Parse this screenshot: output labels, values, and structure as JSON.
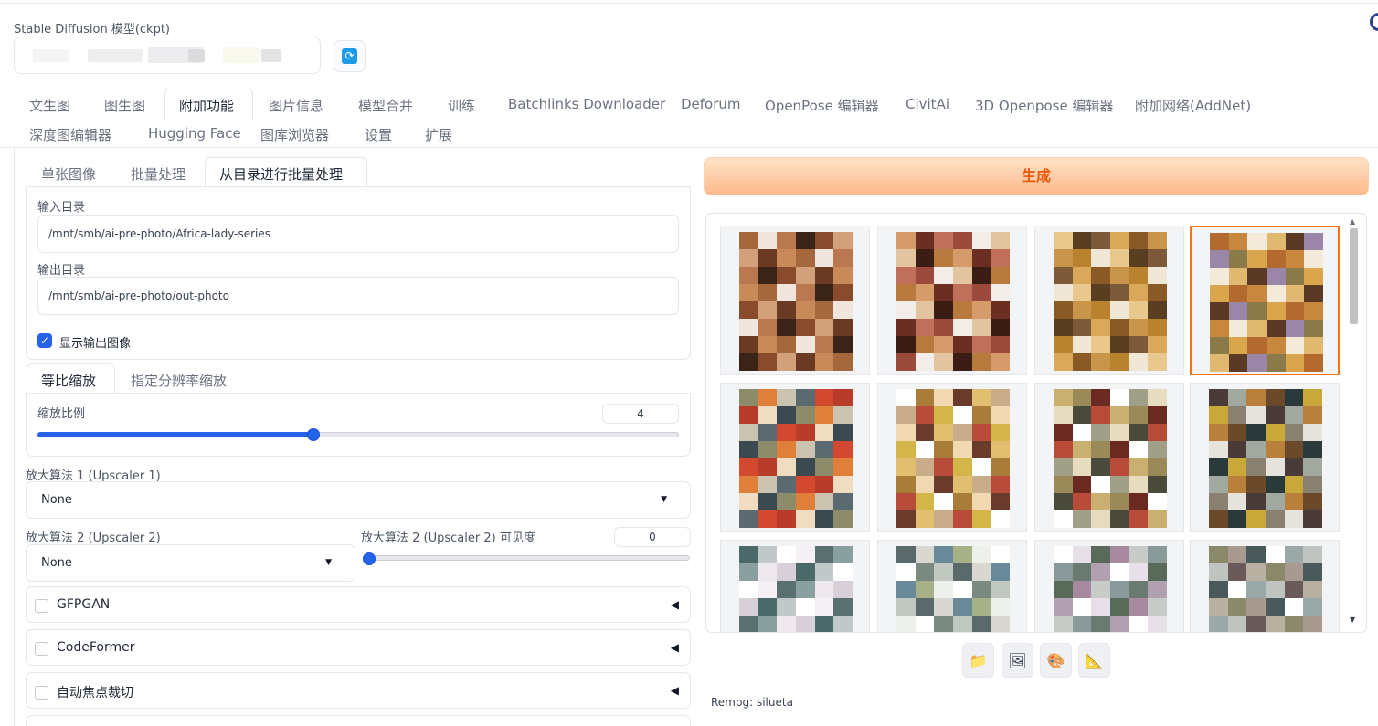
{
  "model": {
    "label": "Stable Diffusion 模型(ckpt)",
    "refresh_icon": "refresh-icon"
  },
  "main_tabs": [
    {
      "label": "文生图"
    },
    {
      "label": "图生图"
    },
    {
      "label": "附加功能",
      "active": true
    },
    {
      "label": "图片信息"
    },
    {
      "label": "模型合并"
    },
    {
      "label": "训练"
    },
    {
      "label": "Batchlinks Downloader"
    },
    {
      "label": "Deforum"
    },
    {
      "label": "OpenPose 编辑器"
    },
    {
      "label": "CivitAi"
    },
    {
      "label": "3D Openpose 编辑器"
    },
    {
      "label": "附加网络(AddNet)"
    },
    {
      "label": "深度图编辑器"
    },
    {
      "label": "Hugging Face"
    },
    {
      "label": "图库浏览器"
    },
    {
      "label": "设置"
    },
    {
      "label": "扩展"
    }
  ],
  "sub_tabs": [
    {
      "label": "单张图像"
    },
    {
      "label": "批量处理"
    },
    {
      "label": "从目录进行批量处理",
      "active": true
    }
  ],
  "batch_dir": {
    "input_label": "输入目录",
    "input_value": "/mnt/smb/ai-pre-photo/Africa-lady-series",
    "output_label": "输出目录",
    "output_value": "/mnt/smb/ai-pre-photo/out-photo",
    "show_output_label": "显示输出图像",
    "show_output_checked": true
  },
  "resize_tabs": [
    {
      "label": "等比缩放",
      "active": true
    },
    {
      "label": "指定分辨率缩放"
    }
  ],
  "scale": {
    "label": "缩放比例",
    "value": "4",
    "level": 0.43
  },
  "upscaler1": {
    "label": "放大算法 1 (Upscaler 1)",
    "value": "None"
  },
  "upscaler2": {
    "label": "放大算法 2 (Upscaler 2)",
    "value": "None",
    "visibility_label": "放大算法 2 (Upscaler 2) 可见度",
    "visibility_value": "0",
    "visibility_level": 0
  },
  "accordions": [
    {
      "label": "GFPGAN"
    },
    {
      "label": "CodeFormer"
    },
    {
      "label": "自动焦点裁切"
    }
  ],
  "generate": {
    "label": "生成"
  },
  "gallery": {
    "selected_index": 3,
    "toolbar_icons": [
      "folder-icon",
      "image-icon",
      "palette-icon",
      "ruler-icon"
    ]
  },
  "status": {
    "rembg_text": "Rembg: silueta"
  },
  "colors": {
    "accent_blue": "#2563eb",
    "generate_orange": "#ea580c",
    "selected_border": "#f97316"
  }
}
